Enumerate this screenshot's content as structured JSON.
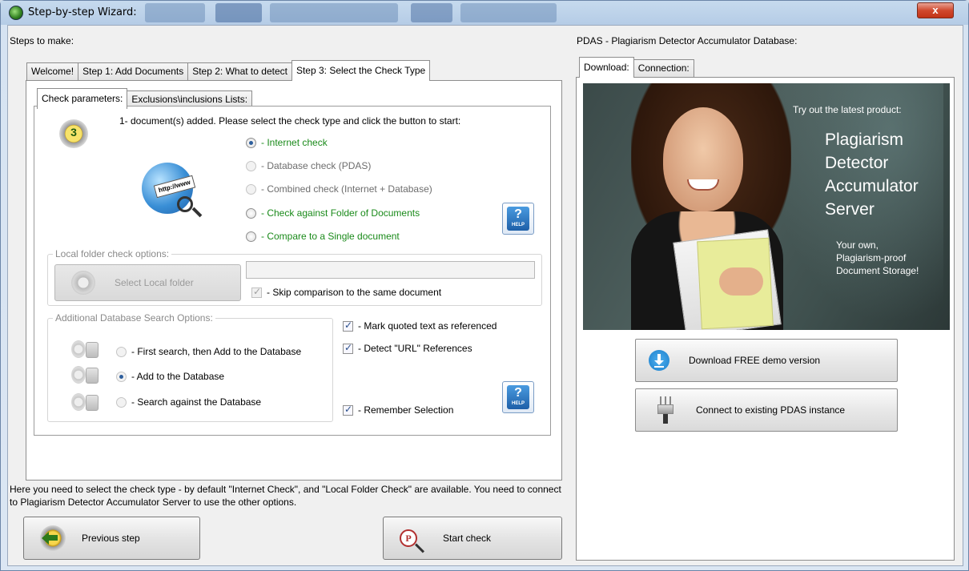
{
  "window": {
    "title": "Step-by-step Wizard:",
    "close_label": "x"
  },
  "left": {
    "group_title": "Steps to make:",
    "tabs": [
      {
        "label": "Welcome!"
      },
      {
        "label": "Step 1: Add Documents"
      },
      {
        "label": "Step 2: What to detect"
      },
      {
        "label": "Step 3: Select the Check Type",
        "active": true
      }
    ],
    "subtabs": [
      {
        "label": "Check parameters:",
        "active": true
      },
      {
        "label": "Exclusions\\inclusions Lists:"
      }
    ],
    "step_number": "3",
    "instruction": "1- document(s) added. Please select the check type and click the button to start:",
    "check_types": [
      {
        "label": "- Internet check",
        "checked": true,
        "enabled": true,
        "color": "#1a8a1a"
      },
      {
        "label": "- Database check (PDAS)",
        "checked": false,
        "enabled": false
      },
      {
        "label": "- Combined check (Internet + Database)",
        "checked": false,
        "enabled": false
      },
      {
        "label": "- Check against Folder of Documents",
        "checked": false,
        "enabled": true,
        "color": "#1a8a1a"
      },
      {
        "label": "- Compare to a Single document",
        "checked": false,
        "enabled": true,
        "color": "#1a8a1a"
      }
    ],
    "globe_label": "http://www",
    "help_label": "?",
    "help_sub": "HELP",
    "local_folder": {
      "legend": "Local folder check options:",
      "select_button": "Select Local folder",
      "path_value": "",
      "skip_label": "- Skip comparison to the same document",
      "skip_checked": true
    },
    "db_options": {
      "legend": "Additional Database Search Options:",
      "items": [
        {
          "label": "- First search, then Add to the Database",
          "checked": false
        },
        {
          "label": "- Add to the Database",
          "checked": true
        },
        {
          "label": "- Search against the Database",
          "checked": false
        }
      ]
    },
    "mark_quoted": {
      "label": "- Mark quoted text as referenced",
      "checked": true
    },
    "detect_url": {
      "label": "- Detect \"URL\" References",
      "checked": true
    },
    "remember": {
      "label": "- Remember Selection",
      "checked": true
    },
    "description": "Here you need to select the check type - by default \"Internet Check\", and \"Local Folder Check\" are available. You need to connect to Plagiarism Detector Accumulator Server to use the other options.",
    "prev_button": "Previous step",
    "start_button": "Start check",
    "start_icon_letter": "P"
  },
  "right": {
    "group_title": "PDAS - Plagiarism Detector Accumulator Database:",
    "tabs": [
      {
        "label": "Download:",
        "active": true
      },
      {
        "label": "Connection:"
      }
    ],
    "promo": {
      "tagline": "Try out the latest product:",
      "product_lines": [
        "Plagiarism",
        "Detector",
        "Accumulator",
        "Server"
      ],
      "sub_lines": [
        "Your own,",
        "Plagiarism-proof",
        "Document Storage!"
      ]
    },
    "download_button": "Download FREE demo version",
    "connect_button": "Connect to existing PDAS instance"
  }
}
